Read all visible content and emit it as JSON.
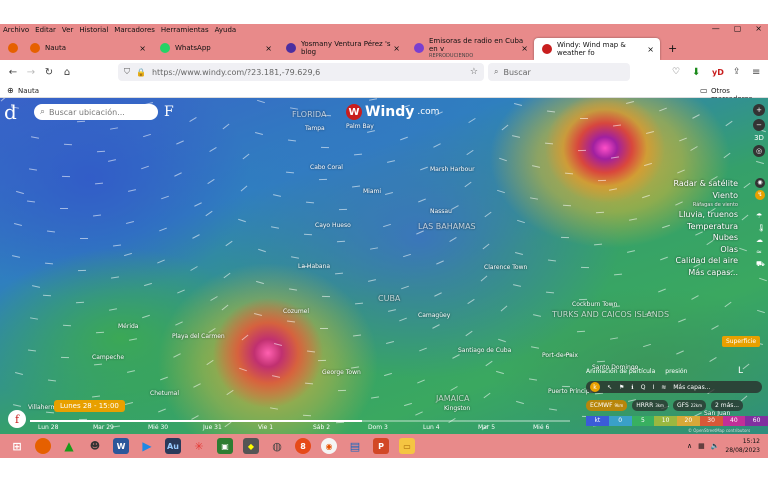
{
  "menu": [
    "Archivo",
    "Editar",
    "Ver",
    "Historial",
    "Marcadores",
    "Herramientas",
    "Ayuda"
  ],
  "tabs": [
    {
      "label": "Nauta",
      "icon": "firefox-icon",
      "color": "#e66000"
    },
    {
      "label": "WhatsApp",
      "icon": "whatsapp-icon",
      "color": "#25d366"
    },
    {
      "label": "Yosmany Ventura Pérez 's blog",
      "icon": "blog-icon",
      "color": "#4b2ea0"
    },
    {
      "label": "Emisoras de radio en Cuba en v",
      "sub": "REPRODUCIENDO",
      "icon": "radio-icon",
      "color": "#7a3fd0"
    },
    {
      "label": "Windy: Wind map & weather fo",
      "icon": "windy-icon",
      "color": "#c81e1e",
      "active": true
    }
  ],
  "url": "https://www.windy.com/?23.181,-79.629,6",
  "search_placeholder": "Buscar",
  "bookmarks": {
    "left": "Nauta",
    "right": "Otros marcadores"
  },
  "map": {
    "logo": "Windy",
    "logo_domain": ".com",
    "search_placeholder": "Buscar ubicación...",
    "places": [
      {
        "name": "FLORIDA",
        "big": true
      },
      {
        "name": "Tampa"
      },
      {
        "name": "Palm Bay"
      },
      {
        "name": "Cabo Coral"
      },
      {
        "name": "Miami"
      },
      {
        "name": "Marsh Harbour"
      },
      {
        "name": "Nassau"
      },
      {
        "name": "LAS BAHAMAS",
        "big": true
      },
      {
        "name": "Cayo Hueso"
      },
      {
        "name": "La Habana"
      },
      {
        "name": "Clarence Town"
      },
      {
        "name": "CUBA",
        "big": true
      },
      {
        "name": "Camagüey"
      },
      {
        "name": "Mérida"
      },
      {
        "name": "Playa del Carmen"
      },
      {
        "name": "Campeche"
      },
      {
        "name": "Cozumel"
      },
      {
        "name": "Santiago de Cuba"
      },
      {
        "name": "George Town"
      },
      {
        "name": "Cockburn Town"
      },
      {
        "name": "TURKS AND CAICOS ISLANDS",
        "big": true
      },
      {
        "name": "Port-de-Paix"
      },
      {
        "name": "Santo Domingo"
      },
      {
        "name": "Puerto Príncipe"
      },
      {
        "name": "Chetumal"
      },
      {
        "name": "JAMAICA",
        "big": true
      },
      {
        "name": "Kingston"
      },
      {
        "name": "Villahermosa"
      },
      {
        "name": "San Juan"
      }
    ],
    "layers": [
      "Radar & satélite",
      "Viento",
      "Ráfagas de viento",
      "Lluvia, truenos",
      "Temperatura",
      "Nubes",
      "Olas",
      "Calidad del aire",
      "Más capas..."
    ],
    "superficie": "Superficie",
    "particle": [
      "Animación de partícula",
      "presión"
    ],
    "tools": [
      "Más capas..."
    ],
    "models": [
      "ECMWF",
      "HRRR",
      "GFS",
      "2 más..."
    ],
    "model_res": [
      "9km",
      "3km",
      "22km"
    ],
    "scale_unit": "kt",
    "scale": [
      "0",
      "5",
      "10",
      "20",
      "30",
      "40",
      "60"
    ],
    "osm": "© OpenStreetMap contributors",
    "date_pill": "Lunes 28 - 15:00",
    "timeline": [
      "Lun 28",
      "Mar 29",
      "Mié 30",
      "Jue 31",
      "Vie 1",
      "Sáb 2",
      "Dom 3",
      "Lun 4",
      "Mar 5",
      "Mié 6"
    ]
  },
  "tray": {
    "time": "15:12",
    "date": "28/08/2023"
  },
  "colors": {
    "chrome": "#e88a8a",
    "accent": "#e8a000",
    "windy_red": "#c81e1e"
  }
}
